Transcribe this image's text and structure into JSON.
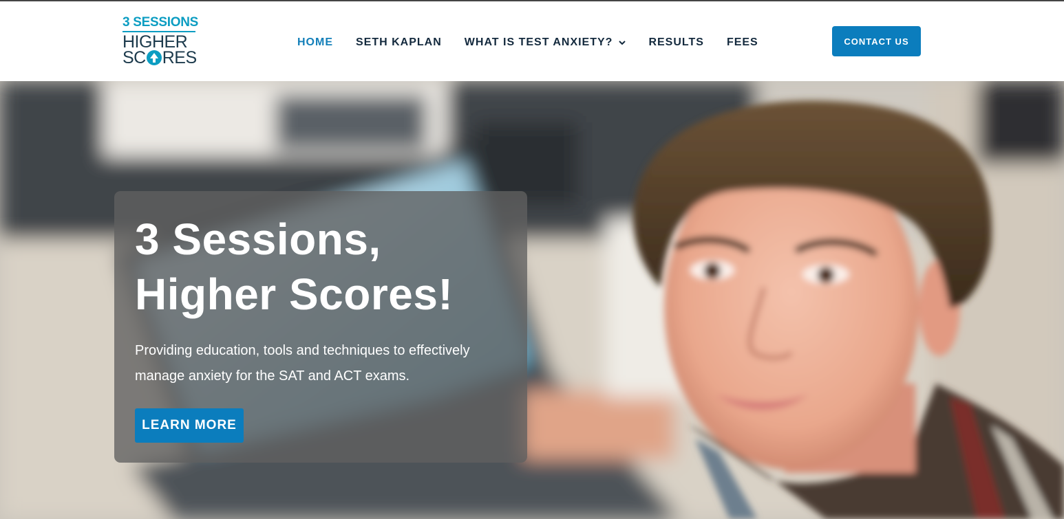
{
  "logo": {
    "line1": "3 SESSIONS",
    "line2": "HIGHER",
    "line3_pre": "SC",
    "line3_post": "RES"
  },
  "nav": {
    "items": [
      {
        "label": "HOME"
      },
      {
        "label": "SETH KAPLAN"
      },
      {
        "label": "WHAT IS TEST ANXIETY?"
      },
      {
        "label": "RESULTS"
      },
      {
        "label": "FEES"
      }
    ],
    "active_index": 0
  },
  "contact_button": "CONTACT US",
  "hero": {
    "headline_line1": "3 Sessions,",
    "headline_line2": "Higher Scores!",
    "subtext": "Providing education, tools and techniques to effectively manage anxiety for the SAT and ACT exams.",
    "cta": "LEARN MORE"
  },
  "colors": {
    "brand_teal": "#0c9dc2",
    "button_blue": "#0b7dbd",
    "nav_active": "#137fb9",
    "nav_text": "#13293d",
    "overlay": "rgba(96,96,96,0.78)"
  },
  "icons": {
    "nav_dropdown": "chevron-down-icon",
    "logo_mark": "up-arrow-icon"
  }
}
